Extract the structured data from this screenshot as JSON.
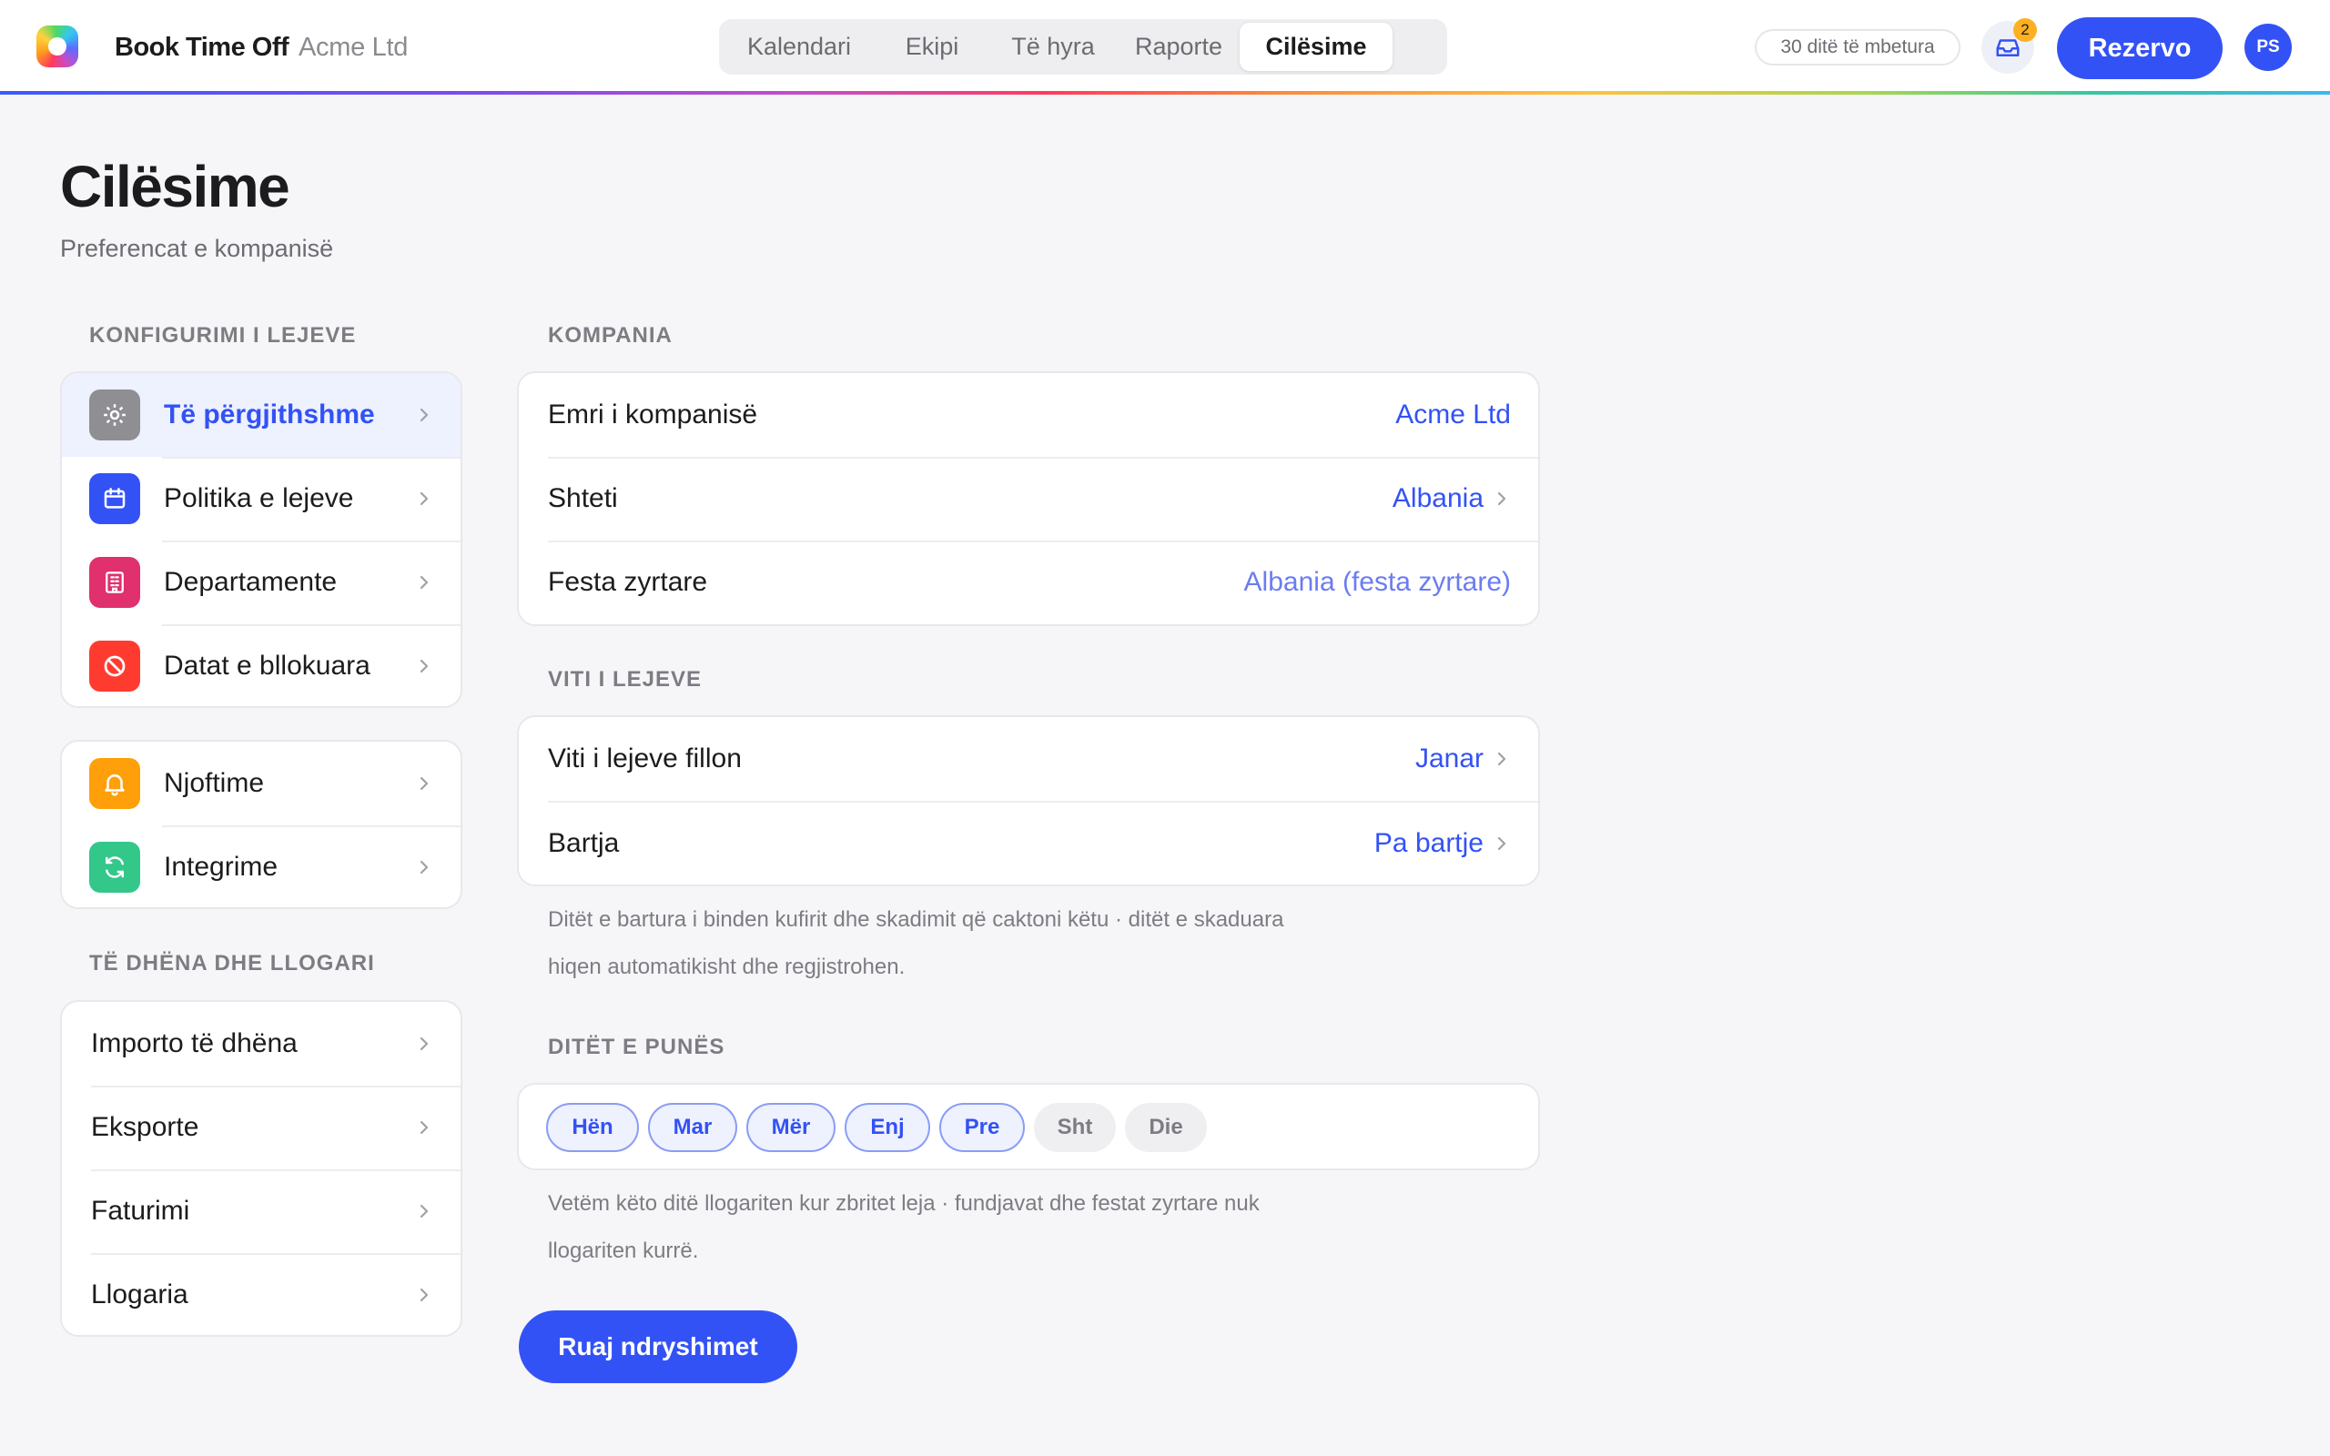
{
  "app": {
    "name": "Book Time Off",
    "company": "Acme Ltd"
  },
  "nav": {
    "tabs": [
      {
        "label": "Kalendari",
        "active": false
      },
      {
        "label": "Ekipi",
        "active": false
      },
      {
        "label": "Të hyra",
        "active": false
      },
      {
        "label": "Raporte",
        "active": false
      },
      {
        "label": "Cilësime",
        "active": true
      }
    ]
  },
  "header": {
    "days_left": "30 ditë të mbetura",
    "inbox_count": "2",
    "book_label": "Rezervo",
    "avatar_initials": "PS"
  },
  "page": {
    "title": "Cilësime",
    "subtitle": "Preferencat e kompanisë"
  },
  "sidebar": {
    "section_leave": "KONFIGURIMI I LEJEVE",
    "leave_items": [
      {
        "label": "Të përgjithshme",
        "icon": "gear-icon",
        "color": "#8e8e93",
        "selected": true
      },
      {
        "label": "Politika e lejeve",
        "icon": "calendar-icon",
        "color": "#3352f5",
        "selected": false
      },
      {
        "label": "Departamente",
        "icon": "building-icon",
        "color": "#e0306e",
        "selected": false
      },
      {
        "label": "Datat e bllokuara",
        "icon": "blocked-icon",
        "color": "#ff3b30",
        "selected": false
      }
    ],
    "other_items": [
      {
        "label": "Njoftime",
        "icon": "bell-icon",
        "color": "#ff9f0a"
      },
      {
        "label": "Integrime",
        "icon": "sync-icon",
        "color": "#34c78a"
      }
    ],
    "section_data": "TË DHËNA DHE LLOGARI",
    "data_items": [
      {
        "label": "Importo të dhëna"
      },
      {
        "label": "Eksporte"
      },
      {
        "label": "Faturimi"
      },
      {
        "label": "Llogaria"
      }
    ]
  },
  "company": {
    "section": "KOMPANIA",
    "rows": [
      {
        "label": "Emri i kompanisë",
        "value": "Acme Ltd"
      },
      {
        "label": "Shteti",
        "value": "Albania"
      },
      {
        "label": "Festa zyrtare",
        "value": "Albania (festa zyrtare)"
      }
    ]
  },
  "leave_year": {
    "section": "VITI I LEJEVE",
    "rows": [
      {
        "label": "Viti i lejeve fillon",
        "value": "Janar"
      },
      {
        "label": "Bartja",
        "value": "Pa bartje"
      }
    ],
    "help_line1": "Ditët e bartura i binden kufirit dhe skadimit që caktoni këtu · ditët e skaduara",
    "help_line2": "hiqen automatikisht dhe regjistrohen."
  },
  "work_days": {
    "section": "DITËT E PUNËS",
    "days": [
      {
        "label": "Hën",
        "on": true
      },
      {
        "label": "Mar",
        "on": true
      },
      {
        "label": "Mër",
        "on": true
      },
      {
        "label": "Enj",
        "on": true
      },
      {
        "label": "Pre",
        "on": true
      },
      {
        "label": "Sht",
        "on": false
      },
      {
        "label": "Die",
        "on": false
      }
    ],
    "help_line1": "Vetëm këto ditë llogariten kur zbritet leja · fundjavat dhe festat zyrtare nuk",
    "help_line2": "llogariten kurrë."
  },
  "actions": {
    "save_label": "Ruaj ndryshimet"
  },
  "colors": {
    "accent": "#3352f5",
    "badge": "#ffb020"
  }
}
